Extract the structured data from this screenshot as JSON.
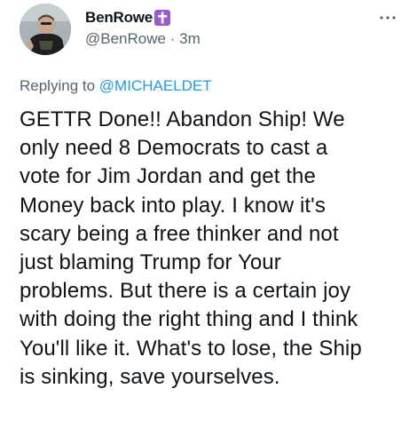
{
  "user": {
    "display_name": "BenRowe",
    "handle": "@BenRowe",
    "separator": "·",
    "time": "3m",
    "badge_icon": "latin-cross-icon"
  },
  "reply": {
    "prefix": "Replying to",
    "mention": "@MICHAELDET"
  },
  "tweet": {
    "text": "GETTR Done!! Abandon Ship!  We\nonly need 8 Democrats to cast a\nvote for Jim Jordan and get the\nMoney back into play.  I know it's\nscary being a free thinker and not\njust blaming Trump for Your\nproblems.  But there is a certain joy\nwith doing the right thing and I think\nYou'll like it.  What's to lose, the Ship\nis sinking, save yourselves."
  },
  "colors": {
    "text_primary": "#0f1419",
    "text_secondary": "#536471",
    "link": "#1d9bf0",
    "badge_bg": "#9b59d0"
  }
}
